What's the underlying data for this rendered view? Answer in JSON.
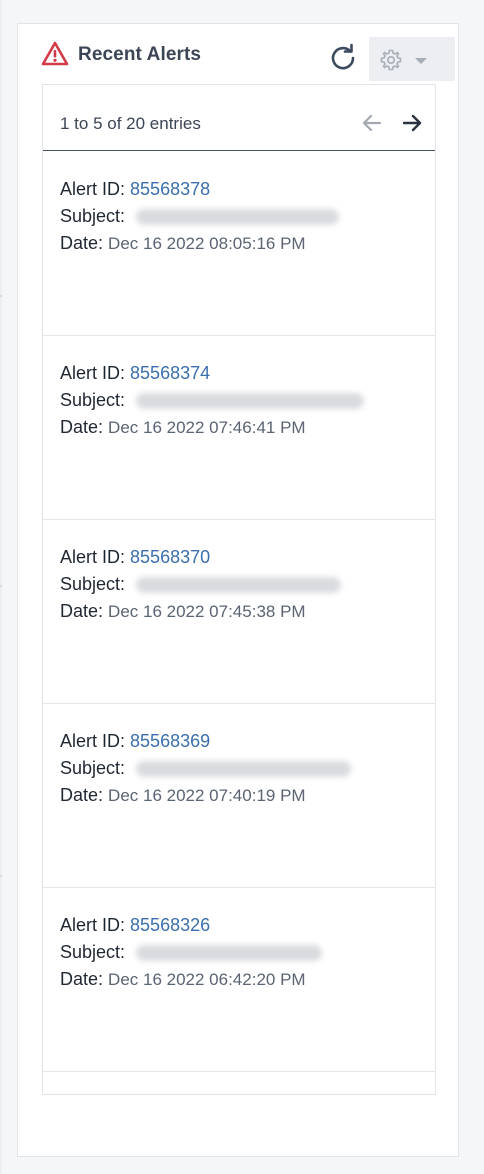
{
  "widget": {
    "title": "Recent Alerts",
    "icons": {
      "alert": "warning-triangle-icon",
      "refresh": "refresh-icon",
      "settings": "gear-icon",
      "dropdown": "caret-down-icon"
    },
    "colors": {
      "alert_icon": "#d23a47",
      "link": "#3a6fae",
      "title": "#3b4556"
    }
  },
  "pager": {
    "text": "1 to 5 of 20 entries",
    "prev_icon": "arrow-left-icon",
    "next_icon": "arrow-right-icon"
  },
  "labels": {
    "alert_id": "Alert ID:",
    "subject": "Subject:",
    "date": "Date:"
  },
  "alerts": [
    {
      "id": "85568378",
      "date": "Dec 16 2022 08:05:16 PM"
    },
    {
      "id": "85568374",
      "date": "Dec 16 2022 07:46:41 PM"
    },
    {
      "id": "85568370",
      "date": "Dec 16 2022 07:45:38 PM"
    },
    {
      "id": "85568369",
      "date": "Dec 16 2022 07:40:19 PM"
    },
    {
      "id": "85568326",
      "date": "Dec 16 2022 06:42:20 PM"
    }
  ]
}
